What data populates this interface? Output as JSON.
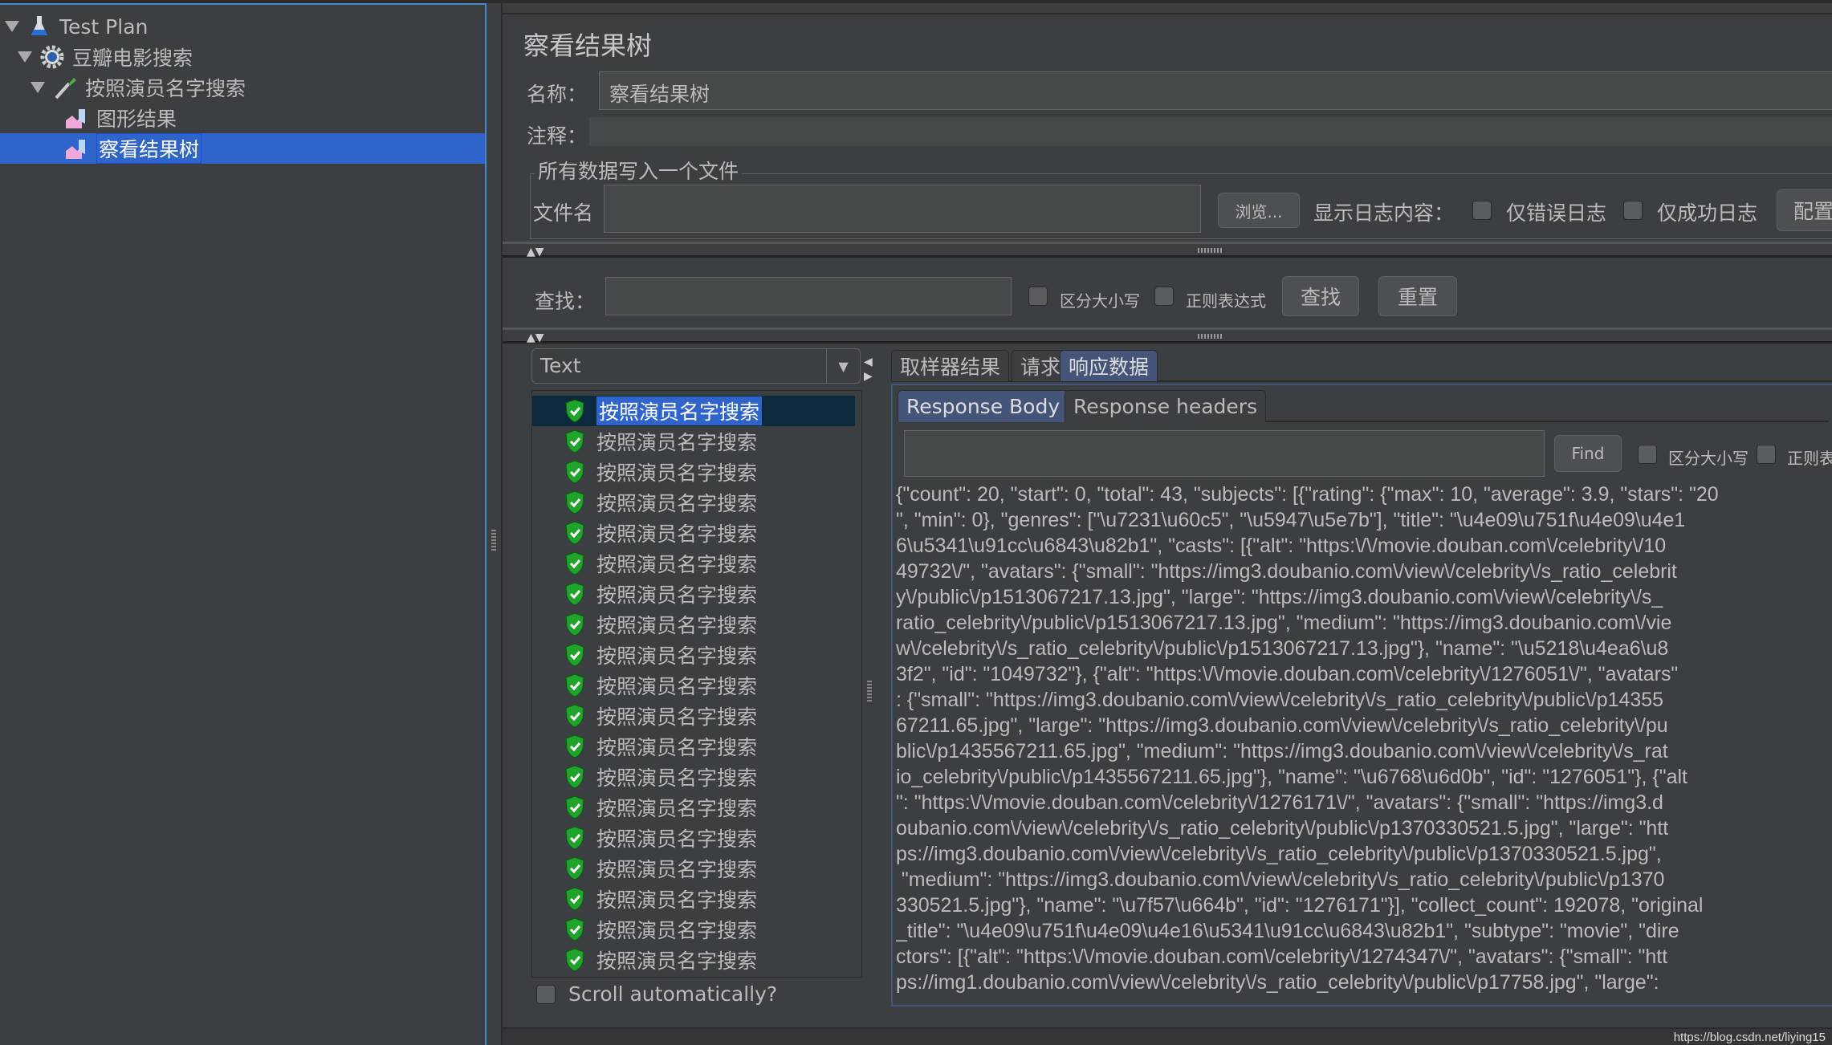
{
  "tree": {
    "items": [
      {
        "label": "Test Plan",
        "icon": "flask-icon"
      },
      {
        "label": "豆瓣电影搜索",
        "icon": "gear-icon"
      },
      {
        "label": "按照演员名字搜索",
        "icon": "pipette-icon"
      },
      {
        "label": "图形结果",
        "icon": "graph-icon"
      },
      {
        "label": "察看结果树",
        "icon": "graph-icon",
        "selected": true
      }
    ]
  },
  "panel": {
    "title": "察看结果树",
    "name_label": "名称：",
    "name_value": "察看结果树",
    "comment_label": "注释：",
    "file_group_title": "所有数据写入一个文件",
    "filename_label": "文件名",
    "filename_value": "",
    "browse_label": "浏览...",
    "log_label": "显示日志内容：",
    "errors_only_label": "仅错误日志",
    "success_only_label": "仅成功日志",
    "configure_label": "配置"
  },
  "search": {
    "label": "查找：",
    "value": "",
    "case_label": "区分大小写",
    "regex_label": "正则表达式",
    "find_label": "查找",
    "reset_label": "重置"
  },
  "results": {
    "renderer": "Text",
    "sample_label": "按照演员名字搜索",
    "sample_count": 19,
    "scroll_auto_label": "Scroll automatically?"
  },
  "tabs": [
    "取样器结果",
    "请求",
    "响应数据"
  ],
  "active_tab": 2,
  "subtabs": [
    "Response Body",
    "Response headers"
  ],
  "response": {
    "find_label": "Find",
    "find_value": "",
    "case_label": "区分大小写",
    "regex_label": "正则表达",
    "lines": [
      "{\"count\": 20, \"start\": 0, \"total\": 43, \"subjects\": [{\"rating\": {\"max\": 10, \"average\": 3.9, \"stars\": \"20",
      "\", \"min\": 0}, \"genres\": [\"\\u7231\\u60c5\", \"\\u5947\\u5e7b\"], \"title\": \"\\u4e09\\u751f\\u4e09\\u4e1",
      "6\\u5341\\u91cc\\u6843\\u82b1\", \"casts\": [{\"alt\": \"https:\\/\\/movie.douban.com\\/celebrity\\/10",
      "49732\\/\", \"avatars\": {\"small\": \"https://img3.doubanio.com\\/view\\/celebrity\\/s_ratio_celebrit",
      "y\\/public\\/p1513067217.13.jpg\", \"large\": \"https://img3.doubanio.com\\/view\\/celebrity\\/s_",
      "ratio_celebrity\\/public\\/p1513067217.13.jpg\", \"medium\": \"https://img3.doubanio.com\\/vie",
      "w\\/celebrity\\/s_ratio_celebrity\\/public\\/p1513067217.13.jpg\"}, \"name\": \"\\u5218\\u4ea6\\u8",
      "3f2\", \"id\": \"1049732\"}, {\"alt\": \"https:\\/\\/movie.douban.com\\/celebrity\\/1276051\\/\", \"avatars\"",
      ": {\"small\": \"https://img3.doubanio.com\\/view\\/celebrity\\/s_ratio_celebrity\\/public\\/p14355",
      "67211.65.jpg\", \"large\": \"https://img3.doubanio.com\\/view\\/celebrity\\/s_ratio_celebrity\\/pu",
      "blic\\/p1435567211.65.jpg\", \"medium\": \"https://img3.doubanio.com\\/view\\/celebrity\\/s_rat",
      "io_celebrity\\/public\\/p1435567211.65.jpg\"}, \"name\": \"\\u6768\\u6d0b\", \"id\": \"1276051\"}, {\"alt",
      "\": \"https:\\/\\/movie.douban.com\\/celebrity\\/1276171\\/\", \"avatars\": {\"small\": \"https://img3.d",
      "oubanio.com\\/view\\/celebrity\\/s_ratio_celebrity\\/public\\/p1370330521.5.jpg\", \"large\": \"htt",
      "ps://img3.doubanio.com\\/view\\/celebrity\\/s_ratio_celebrity\\/public\\/p1370330521.5.jpg\",",
      " \"medium\": \"https://img3.doubanio.com\\/view\\/celebrity\\/s_ratio_celebrity\\/public\\/p1370",
      "330521.5.jpg\"}, \"name\": \"\\u7f57\\u664b\", \"id\": \"1276171\"}], \"collect_count\": 192078, \"original",
      "_title\": \"\\u4e09\\u751f\\u4e09\\u4e16\\u5341\\u91cc\\u6843\\u82b1\", \"subtype\": \"movie\", \"dire",
      "ctors\": [{\"alt\": \"https:\\/\\/movie.douban.com\\/celebrity\\/1274347\\/\", \"avatars\": {\"small\": \"htt",
      "ps://img1.doubanio.com\\/view\\/celebrity\\/s_ratio_celebrity\\/public\\/p17758.jpg\", \"large\":"
    ]
  },
  "watermark": "https://blog.csdn.net/liying15",
  "colors": {
    "selection": "#2f65ca",
    "background": "#3c3f41",
    "success": "#1fa32a"
  }
}
